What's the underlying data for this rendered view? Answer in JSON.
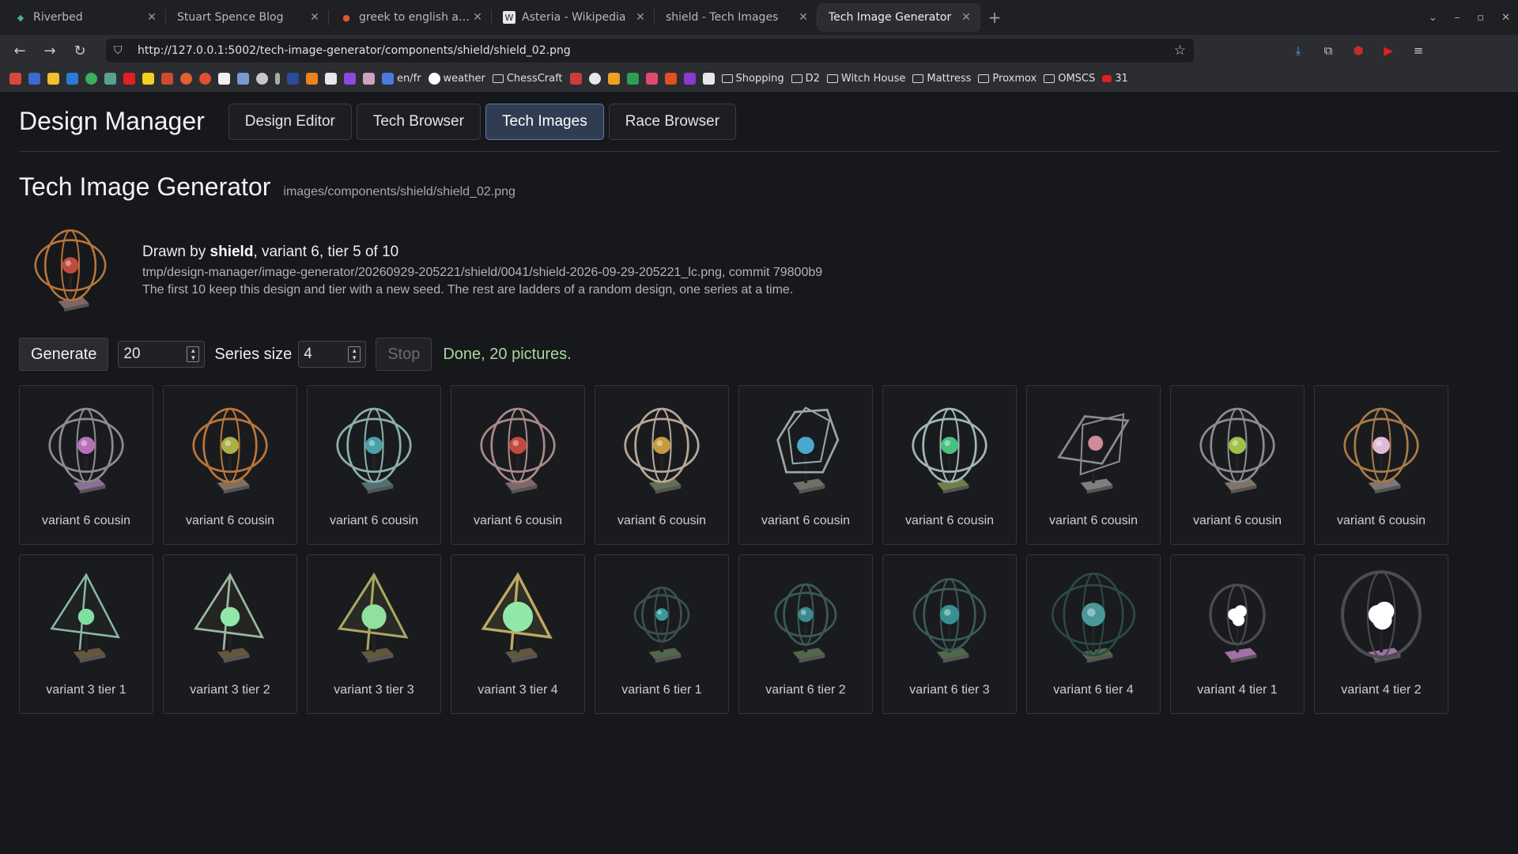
{
  "browser": {
    "tabs": [
      {
        "title": "Riverbed",
        "favicon": "riverbed-icon",
        "active": false
      },
      {
        "title": "Stuart Spence Blog",
        "favicon": "",
        "active": false
      },
      {
        "title": "greek to english at DuckDuckGo",
        "favicon": "duckduckgo-icon",
        "active": false
      },
      {
        "title": "Asteria - Wikipedia",
        "favicon": "wikipedia-icon",
        "active": false
      },
      {
        "title": "shield - Tech Images",
        "favicon": "",
        "active": false
      },
      {
        "title": "Tech Image Generator",
        "favicon": "",
        "active": true
      }
    ],
    "url": "http://127.0.0.1:5002/tech-image-generator/components/shield/shield_02.png",
    "bookmarks": [
      {
        "type": "label",
        "text": "en/fr"
      },
      {
        "type": "label",
        "text": "weather"
      },
      {
        "type": "folder",
        "text": "ChessCraft"
      },
      {
        "type": "folder",
        "text": "Shopping"
      },
      {
        "type": "folder",
        "text": "D2"
      },
      {
        "type": "folder",
        "text": "Witch House"
      },
      {
        "type": "folder",
        "text": "Mattress"
      },
      {
        "type": "folder",
        "text": "Proxmox"
      },
      {
        "type": "folder",
        "text": "OMSCS"
      },
      {
        "type": "label",
        "text": "31"
      }
    ]
  },
  "app": {
    "brand": "Design Manager",
    "nav": [
      {
        "label": "Design Editor",
        "active": false
      },
      {
        "label": "Tech Browser",
        "active": false
      },
      {
        "label": "Tech Images",
        "active": true
      },
      {
        "label": "Race Browser",
        "active": false
      }
    ]
  },
  "generator": {
    "heading": "Tech Image Generator",
    "path": "images/components/shield/shield_02.png",
    "drawn_by_prefix": "Drawn by ",
    "drawn_by_name": "shield",
    "drawn_by_suffix": ", variant 6, tier 5 of 10",
    "file_line": "tmp/design-manager/image-generator/20260929-205221/shield/0041/shield-2026-09-29-205221_lc.png, commit 79800b9",
    "description": "The first 10 keep this design and tier with a new seed. The rest are ladders of a random design, one series at a time.",
    "generate_label": "Generate",
    "count_value": "20",
    "series_label": "Series size",
    "series_value": "4",
    "stop_label": "Stop",
    "status": "Done, 20 pictures."
  },
  "images": [
    {
      "caption": "variant 6 cousin",
      "shape": "sphere",
      "ring": "#8a8c90",
      "core": "#b86fb8",
      "base": "#9a7aa0"
    },
    {
      "caption": "variant 6 cousin",
      "shape": "sphere",
      "ring": "#b8763a",
      "core": "#a8b048",
      "base": "#8a7a6a"
    },
    {
      "caption": "variant 6 cousin",
      "shape": "sphere",
      "ring": "#8ab0aa",
      "core": "#4aa0a8",
      "base": "#5a7a80"
    },
    {
      "caption": "variant 6 cousin",
      "shape": "sphere",
      "ring": "#a88a88",
      "core": "#c04a40",
      "base": "#8a7070"
    },
    {
      "caption": "variant 6 cousin",
      "shape": "sphere",
      "ring": "#b8a898",
      "core": "#c89a40",
      "base": "#6a7a5a"
    },
    {
      "caption": "variant 6 cousin",
      "shape": "poly",
      "ring": "#9aa8ac",
      "core": "#4aa8d0",
      "base": "#7a7a70"
    },
    {
      "caption": "variant 6 cousin",
      "shape": "sphere",
      "ring": "#a0b8b0",
      "core": "#48c080",
      "base": "#7a8a50"
    },
    {
      "caption": "variant 6 cousin",
      "shape": "planes",
      "ring": "#8a8c90",
      "core": "#d08a98",
      "base": "#8a8a8a"
    },
    {
      "caption": "variant 6 cousin",
      "shape": "sphere",
      "ring": "#8a8c90",
      "core": "#a0c048",
      "base": "#8a8070"
    },
    {
      "caption": "variant 6 cousin",
      "shape": "sphere",
      "ring": "#a87a48",
      "core": "#e0b8d8",
      "base": "#8a8080"
    },
    {
      "caption": "variant 3 tier 1",
      "shape": "tri",
      "ring": "#8ab8a8",
      "core": "#80e0a0",
      "base": "#6a6040",
      "size": 0.35
    },
    {
      "caption": "variant 3 tier 2",
      "shape": "tri",
      "ring": "#9ab8a0",
      "core": "#90e8a8",
      "base": "#6a6040",
      "size": 0.5
    },
    {
      "caption": "variant 3 tier 3",
      "shape": "tri",
      "ring": "#a8a860",
      "core": "#90e0a0",
      "base": "#6a6040",
      "size": 0.75
    },
    {
      "caption": "variant 3 tier 4",
      "shape": "tri",
      "ring": "#c0a860",
      "core": "#90e8a8",
      "base": "#6a6040",
      "size": 1.0
    },
    {
      "caption": "variant 6 tier 1",
      "shape": "sphere2",
      "ring": "#3a5050",
      "core": "#3a9a98",
      "base": "#5a7050",
      "size": 0.35
    },
    {
      "caption": "variant 6 tier 2",
      "shape": "sphere2",
      "ring": "#3a5a58",
      "core": "#3a8a90",
      "base": "#5a7050",
      "size": 0.5
    },
    {
      "caption": "variant 6 tier 3",
      "shape": "sphere2",
      "ring": "#3a5a58",
      "core": "#3a9090",
      "base": "#5a7050",
      "size": 0.75
    },
    {
      "caption": "variant 6 tier 4",
      "shape": "sphere2",
      "ring": "#2a4a48",
      "core": "#4a9898",
      "base": "#5a7050",
      "size": 1.0
    },
    {
      "caption": "variant 4 tier 1",
      "shape": "blob",
      "ring": "#4a4c50",
      "core": "#ffffff",
      "base": "#b07ab8",
      "size": 0.45
    },
    {
      "caption": "variant 4 tier 2",
      "shape": "blob",
      "ring": "#4a4c50",
      "core": "#ffffff",
      "base": "#b07ab8",
      "size": 1.0
    }
  ]
}
